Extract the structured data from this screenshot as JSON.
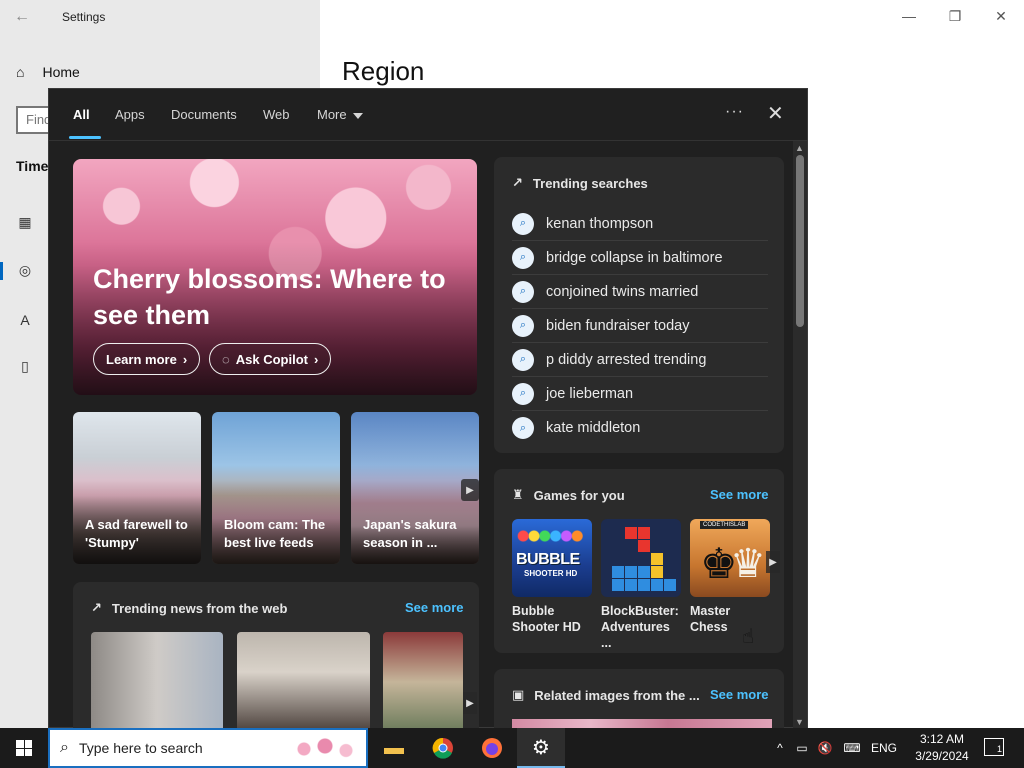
{
  "settings": {
    "window_title": "Settings",
    "home_label": "Home",
    "find_placeholder": "Find",
    "section_label": "Time",
    "page_title": "Region"
  },
  "flyout": {
    "tabs": [
      {
        "label": "All",
        "active": true
      },
      {
        "label": "Apps"
      },
      {
        "label": "Documents"
      },
      {
        "label": "Web"
      },
      {
        "label": "More"
      }
    ],
    "more_options": "···",
    "close_glyph": "✕",
    "hero": {
      "title": "Cherry blossoms: Where to see them",
      "learn_more": "Learn more",
      "ask_copilot": "Ask Copilot"
    },
    "thumbnails": [
      {
        "caption": "A sad farewell to 'Stumpy'"
      },
      {
        "caption": "Bloom cam: The best live feeds"
      },
      {
        "caption": "Japan's sakura season in ..."
      }
    ],
    "trending_news": {
      "heading": "Trending news from the web",
      "see_more": "See more"
    },
    "trending_searches": {
      "heading": "Trending searches",
      "items": [
        "kenan thompson",
        "bridge collapse in baltimore",
        "conjoined twins married",
        "biden fundraiser today",
        "p diddy arrested trending",
        "joe lieberman",
        "kate middleton"
      ]
    },
    "games": {
      "heading": "Games for you",
      "see_more": "See more",
      "items": [
        {
          "name": "Bubble Shooter HD"
        },
        {
          "name": "BlockBuster: Adventures ..."
        },
        {
          "name": "Master Chess"
        }
      ],
      "bubble_logo": "BUBBLE",
      "bubble_sub": "SHOOTER HD",
      "chess_badge": "CODETHISLAB"
    },
    "related_images": {
      "heading": "Related images from the ...",
      "see_more": "See more"
    }
  },
  "taskbar": {
    "search_placeholder": "Type here to search",
    "language": "ENG",
    "time": "3:12 AM",
    "date": "3/29/2024",
    "notification_count": "1"
  },
  "colors": {
    "accent": "#4cc2ff",
    "flyout_bg": "#202020",
    "card_bg": "#2b2b2b",
    "taskbar_bg": "#1b1b1b"
  }
}
